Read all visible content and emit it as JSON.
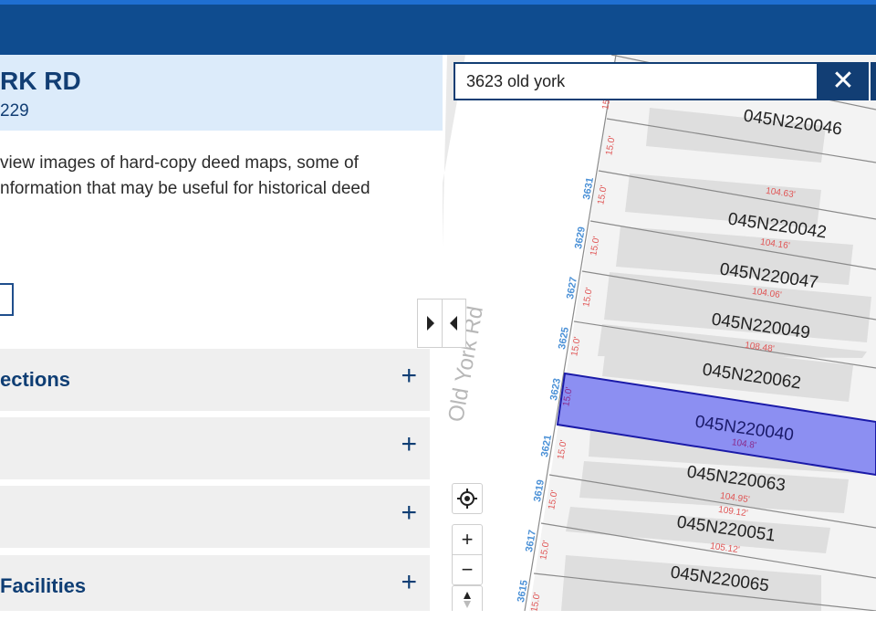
{
  "sidebar": {
    "address_title": "RK RD",
    "address_subtitle": "229",
    "description_lines": [
      "view images of hard-copy deed maps, some of",
      "nformation that may be useful for historical deed"
    ],
    "accordions": [
      {
        "label": "ections"
      },
      {
        "label": ""
      },
      {
        "label": ""
      },
      {
        "label": "Facilities"
      }
    ]
  },
  "search": {
    "value": "3623 old york",
    "clear_icon": "close-icon"
  },
  "map": {
    "road_name": "Old York Rd",
    "toggle_icons": [
      "caret-right-icon",
      "caret-left-icon"
    ],
    "controls": {
      "locate_icon": "crosshair-icon",
      "zoom_in": "+",
      "zoom_out": "−",
      "north_icon": "compass-icon"
    },
    "highlight_color": "#8c8ff2",
    "parcel_line_color": "#808080",
    "parcels": [
      {
        "id": "045N220046"
      },
      {
        "id": "045N220042"
      },
      {
        "id": "045N220047"
      },
      {
        "id": "045N220049"
      },
      {
        "id": "045N220062"
      },
      {
        "id": "045N220040",
        "selected": true
      },
      {
        "id": "045N220063"
      },
      {
        "id": "045N220051"
      },
      {
        "id": "045N220065"
      }
    ],
    "house_numbers": [
      "3631",
      "3629",
      "3627",
      "3625",
      "3623",
      "3621",
      "3619",
      "3617",
      "3615"
    ],
    "frontage_labels": [
      "15.0'",
      "15.0'",
      "15.0'",
      "15.0'",
      "15.0'",
      "15.0'",
      "15.0'",
      "15.0'",
      "15.0'",
      "15.0'",
      "15.0'"
    ],
    "depth_labels": [
      "104.63'",
      "104.16'",
      "104.06'",
      "108.48'",
      "104.8'",
      "104.95'",
      "109.12'",
      "105.12'"
    ]
  }
}
